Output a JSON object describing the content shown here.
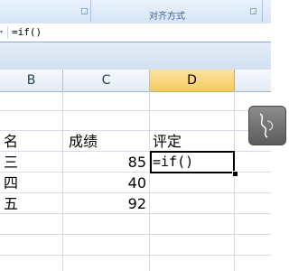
{
  "ribbon": {
    "group_label": "对齐方式"
  },
  "formula_bar": {
    "value": "=if()"
  },
  "columns": [
    "B",
    "C",
    "D"
  ],
  "active_column": "D",
  "sheet": {
    "header_row": {
      "b": "名",
      "c": "成绩",
      "d": "评定"
    },
    "rows": [
      {
        "b": "三",
        "c": "85",
        "d": "=if()"
      },
      {
        "b": "四",
        "c": "40",
        "d": ""
      },
      {
        "b": "五",
        "c": "92",
        "d": ""
      }
    ]
  },
  "icons": {
    "floating_widget": "drawing-widget-icon"
  }
}
